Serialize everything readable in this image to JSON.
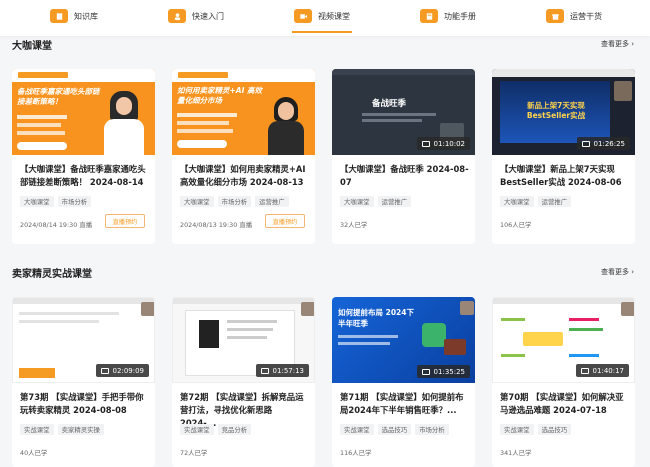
{
  "nav": [
    {
      "label": "知识库"
    },
    {
      "label": "快速入门"
    },
    {
      "label": "视频课堂"
    },
    {
      "label": "功能手册"
    },
    {
      "label": "运营干货"
    }
  ],
  "sections": [
    {
      "title": "大咖课堂",
      "see_more": "查看更多 ›",
      "cards": [
        {
          "title": "【大咖课堂】备战旺季嘉家通吃头部链接差断策略！ 2024-08-14",
          "tags": [
            "大咖课堂",
            "市场分析"
          ],
          "meta": "2024/08/14 19:30 直播",
          "button": "直播预约",
          "thumb_heading": "备战旺季嘉家通吃头部链接差断策略！"
        },
        {
          "title": "【大咖课堂】如何用卖家精灵+AI高效量化细分市场 2024-08-13",
          "tags": [
            "大咖课堂",
            "市场分析",
            "运营推广"
          ],
          "meta": "2024/08/13 19:30 直播",
          "button": "直播预约",
          "thumb_heading": "如何用卖家精灵+AI 高效量化细分市场"
        },
        {
          "title": "【大咖课堂】备战旺季 2024-08-07",
          "tags": [
            "大咖课堂",
            "运营推广"
          ],
          "meta": "32人已学",
          "duration": "01:10:02",
          "thumb_heading": "备战旺季"
        },
        {
          "title": "【大咖课堂】新品上架7天实现BestSeller实战 2024-08-06",
          "tags": [
            "大咖课堂",
            "运营推广"
          ],
          "meta": "106人已学",
          "duration": "01:26:25",
          "thumb_heading": "新品上架7天实现 BestSeller实战"
        }
      ]
    },
    {
      "title": "卖家精灵实战课堂",
      "see_more": "查看更多 ›",
      "cards": [
        {
          "title": "第73期 【实战课堂】手把手带你玩转卖家精灵 2024-08-08",
          "tags": [
            "实战课堂",
            "卖家精灵实操"
          ],
          "meta": "40人已学",
          "duration": "02:09:09"
        },
        {
          "title": "第72期 【实战课堂】拆解竞品运营打法，寻找优化新思路 2024-...",
          "tags": [
            "实战课堂",
            "竞品分析"
          ],
          "meta": "72人已学",
          "duration": "01:57:13"
        },
        {
          "title": "第71期 【实战课堂】如何提前布局2024年下半年销售旺季？...",
          "tags": [
            "实战课堂",
            "选品技巧",
            "市场分析"
          ],
          "meta": "116人已学",
          "duration": "01:35:25",
          "thumb_heading": "如何提前布局 2024下半年旺季"
        },
        {
          "title": "第70期 【实战课堂】如何解决亚马逊选品难题 2024-07-18",
          "tags": [
            "实战课堂",
            "选品技巧"
          ],
          "meta": "341人已学",
          "duration": "01:40:17"
        }
      ]
    }
  ],
  "colors": {
    "accent": "#f59a23",
    "orange_banner": "#f7931e",
    "dark_banner": "#2d3540"
  }
}
